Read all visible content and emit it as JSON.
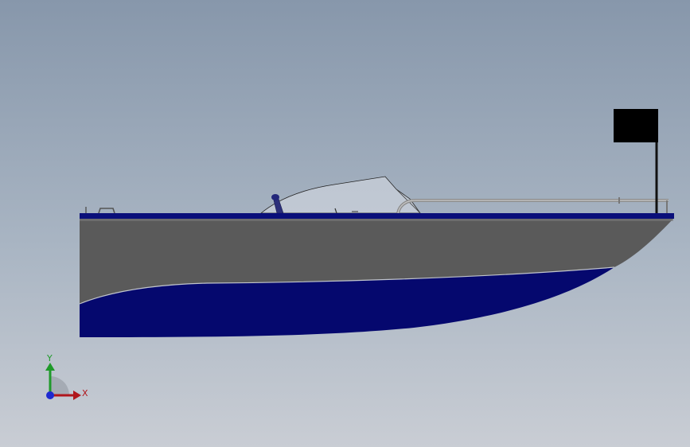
{
  "viewport": {
    "background_top": "#8797ab",
    "background_bottom": "#c9cdd4"
  },
  "model": {
    "hull_color": "#5a5a5a",
    "bottom_color": "#05086e",
    "deck_trim_color": "#0a0f7a",
    "rail_color": "#9a9a9a",
    "windshield_color": "#d9dde3",
    "flag_color": "#000000"
  },
  "triad": {
    "x_label": "X",
    "y_label": "Y",
    "x_color": "#b0161c",
    "y_color": "#1f9a2a",
    "z_color": "#1e2ad0"
  }
}
